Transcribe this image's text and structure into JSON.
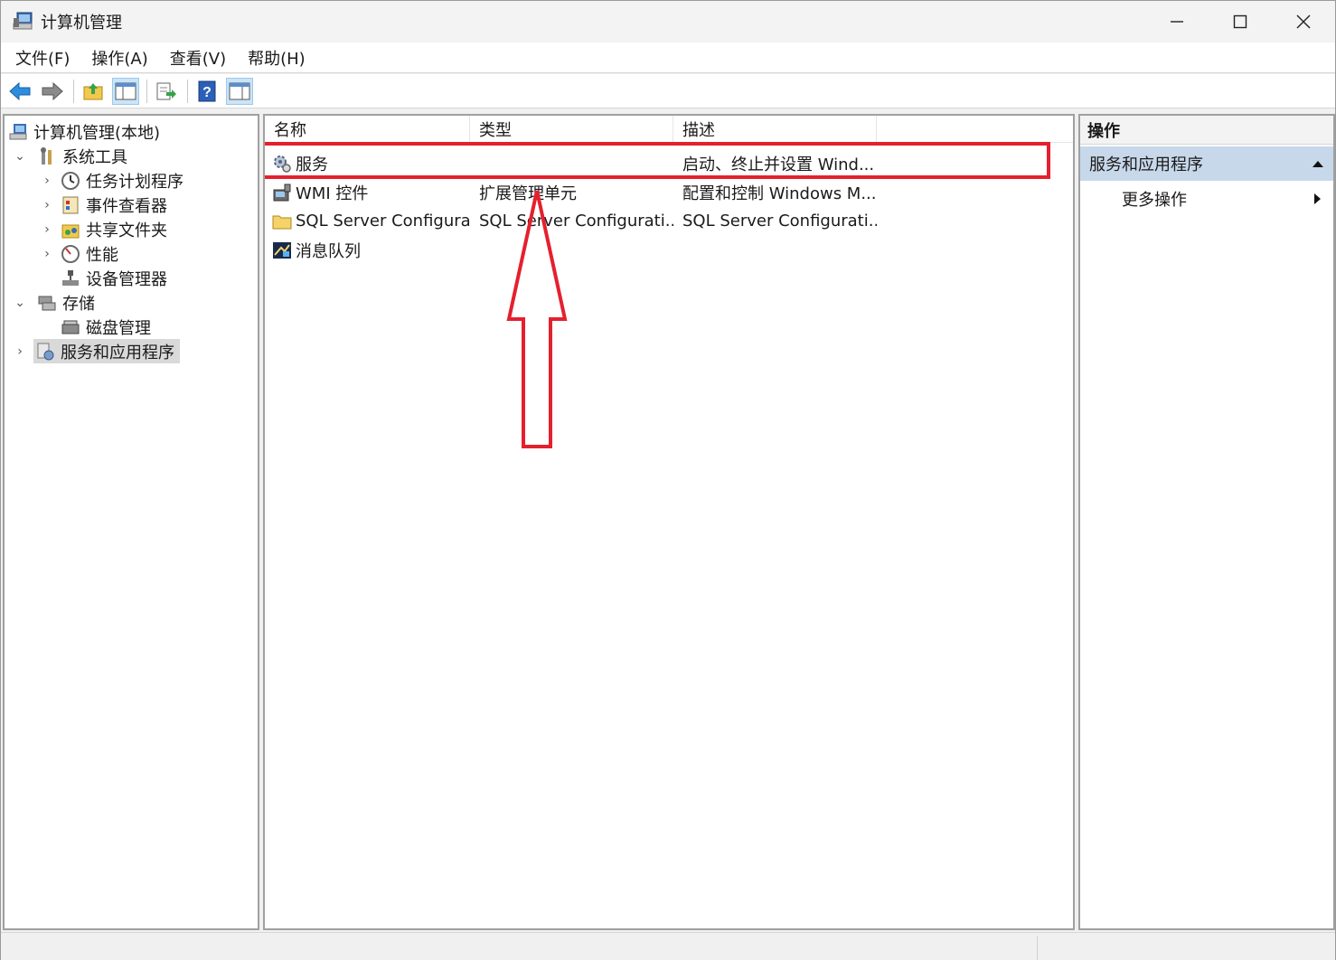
{
  "window": {
    "title": "计算机管理",
    "icons": {
      "app": "computer-management-icon",
      "minimize": "minimize-icon",
      "maximize": "maximize-icon",
      "close": "close-icon"
    }
  },
  "menu": [
    "文件(F)",
    "操作(A)",
    "查看(V)",
    "帮助(H)"
  ],
  "toolbar": [
    "back-arrow-icon",
    "forward-arrow-icon",
    "up-folder-icon",
    "show-hide-tree-icon",
    "export-list-icon",
    "help-icon",
    "show-hide-action-pane-icon"
  ],
  "tree": {
    "root": "计算机管理(本地)",
    "system_tools": "系统工具",
    "task_scheduler": "任务计划程序",
    "event_viewer": "事件查看器",
    "shared_folders": "共享文件夹",
    "performance": "性能",
    "device_manager": "设备管理器",
    "storage": "存储",
    "disk_management": "磁盘管理",
    "services_apps": "服务和应用程序"
  },
  "list": {
    "columns": [
      "名称",
      "类型",
      "描述"
    ],
    "rows": [
      {
        "name": "服务",
        "type": "",
        "desc": "启动、终止并设置 Wind...",
        "icon": "services-gear-icon"
      },
      {
        "name": "WMI 控件",
        "type": "扩展管理单元",
        "desc": "配置和控制 Windows M...",
        "icon": "wmi-control-icon"
      },
      {
        "name": "SQL Server Configura...",
        "type": "SQL Server Configurati...",
        "desc": "SQL Server Configurati...",
        "icon": "folder-icon"
      },
      {
        "name": "消息队列",
        "type": "",
        "desc": "",
        "icon": "message-queue-icon"
      }
    ]
  },
  "actions": {
    "header": "操作",
    "section": "服务和应用程序",
    "more": "更多操作"
  },
  "colors": {
    "highlight": "#e5202e",
    "selection": "#c7d8ea"
  }
}
